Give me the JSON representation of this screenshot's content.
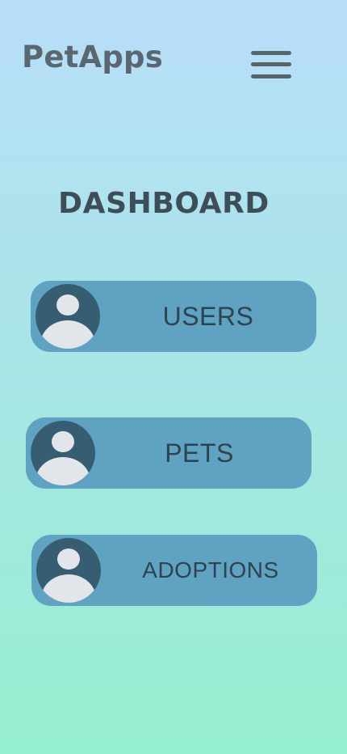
{
  "app": {
    "brand": "PetApps",
    "menu_icon": "hamburger-menu-icon"
  },
  "page": {
    "title": "DASHBOARD"
  },
  "nav_cards": [
    {
      "label": "USERS",
      "icon": "user-avatar-icon"
    },
    {
      "label": "PETS",
      "icon": "user-avatar-icon"
    },
    {
      "label": "ADOPTIONS",
      "icon": "user-avatar-icon"
    }
  ],
  "colors": {
    "background_top": "#b8def9",
    "background_bottom": "#96efd0",
    "card": "#5fa2c2",
    "avatar": "#375d72",
    "text_dark": "#3e4e58"
  }
}
